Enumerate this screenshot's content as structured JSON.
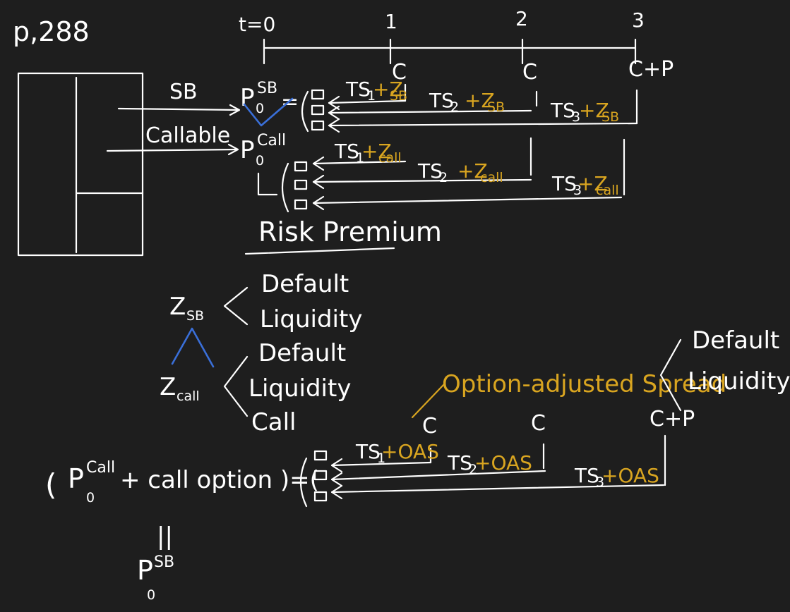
{
  "page_ref": "p,288",
  "timeline": {
    "t0": "t=0",
    "t1": "1",
    "t2": "2",
    "t3": "3"
  },
  "cashflow_labels": {
    "c": "C",
    "cp": "C+P"
  },
  "bond_labels": {
    "sb": "SB",
    "callable": "Callable"
  },
  "price": {
    "p": "P",
    "sub0": "0",
    "sup_sb": "SB",
    "sup_call": "Call"
  },
  "discount": {
    "ts1": "TS",
    "ts1_sub": "1",
    "ts2": "TS",
    "ts2_sub": "2",
    "ts3": "TS",
    "ts3_sub": "3",
    "plus_z_sb": "+Z",
    "sb_sub": "SB",
    "plus_z_call": "+Z",
    "call_sub": "call",
    "plus_oas": "+OAS"
  },
  "risk_premium": "Risk Premium",
  "z_sb": {
    "z": "Z",
    "sub": "SB",
    "components": [
      "Default",
      "Liquidity"
    ]
  },
  "z_call": {
    "z": "Z",
    "sub": "call",
    "components": [
      "Default",
      "Liquidity",
      "Call"
    ]
  },
  "oas": {
    "label": "Option-adjusted Spread",
    "components": [
      "Default",
      "Liquidity"
    ]
  },
  "equation": {
    "open": "(",
    "p": "P",
    "sup": "Call",
    "sub": "0",
    "rest": "+ call option )=(",
    "equals": "||"
  },
  "colors": {
    "background": "#1e1e1e",
    "ink": "#ffffff",
    "highlight": "#d9a520",
    "accent": "#3a6fd8"
  }
}
